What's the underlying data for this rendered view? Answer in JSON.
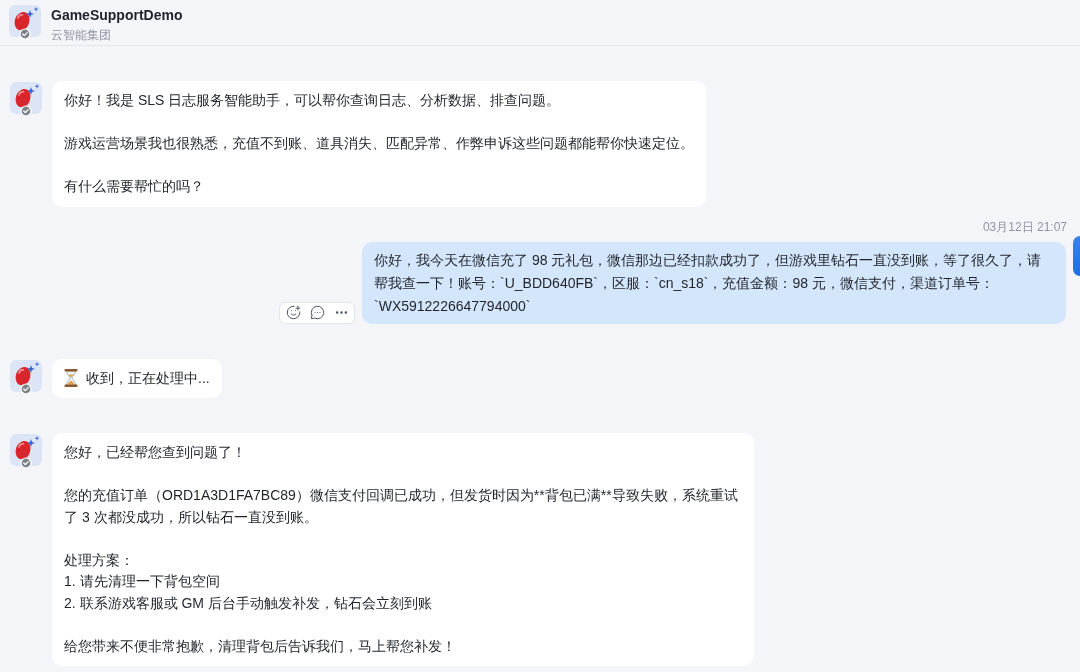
{
  "header": {
    "title": "GameSupportDemo",
    "subtitle": "云智能集团"
  },
  "messages": [
    {
      "kind": "bot",
      "pending": false,
      "paragraphs": [
        [
          "你好！我是 SLS 日志服务智能助手，可以帮你查询日志、分析数据、排查问题。"
        ],
        [
          "游戏运营场景我也很熟悉，充值不到账、道具消失、匹配异常、作弊申诉这些问题都能帮你快速定位。"
        ],
        [
          "有什么需要帮忙的吗？"
        ]
      ]
    },
    {
      "kind": "user",
      "time": "03月12日 21:07",
      "actions_visible": true,
      "text": "你好，我今天在微信充了 98 元礼包，微信那边已经扣款成功了，但游戏里钻石一直没到账，等了很久了，请帮我查一下！账号：`U_BDD640FB`，区服：`cn_s18`，充值金额：98 元，微信支付，渠道订单号：`WX5912226647794000`"
    },
    {
      "kind": "bot",
      "pending": true,
      "paragraphs": [
        [
          "收到，正在处理中..."
        ]
      ]
    },
    {
      "kind": "bot",
      "pending": false,
      "paragraphs": [
        [
          "您好，已经帮您查到问题了！"
        ],
        [
          "您的充值订单（ORD1A3D1FA7BC89）微信支付回调已成功，但发货时因为**背包已满**导致失败，系统重试了 3 次都没成功，所以钻石一直没到账。"
        ],
        [
          "处理方案：",
          "1. 请先清理一下背包空间",
          "2. 联系游戏客服或 GM 后台手动触发补发，钻石会立刻到账"
        ],
        [
          "给您带来不便非常抱歉，清理背包后告诉我们，马上帮您补发！"
        ]
      ]
    }
  ]
}
